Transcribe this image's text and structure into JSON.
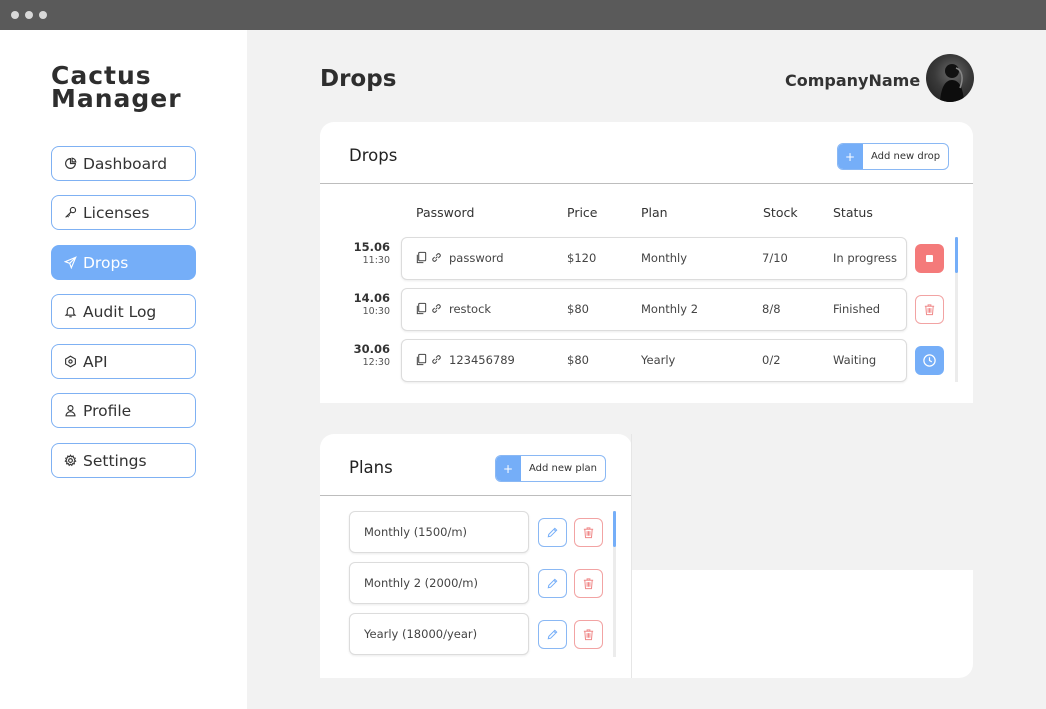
{
  "sidebar": {
    "brand_line1": "Cactus",
    "brand_line2": "Manager",
    "items": [
      {
        "label": "Dashboard",
        "icon": "pie-chart-icon"
      },
      {
        "label": "Licenses",
        "icon": "key-icon"
      },
      {
        "label": "Drops",
        "icon": "send-icon",
        "active": true
      },
      {
        "label": "Audit Log",
        "icon": "bell-icon"
      },
      {
        "label": "API",
        "icon": "api-icon"
      },
      {
        "label": "Profile",
        "icon": "user-icon"
      },
      {
        "label": "Settings",
        "icon": "gear-icon"
      }
    ]
  },
  "header": {
    "title": "Drops",
    "company": "CompanyName",
    "avatar_icon": "avatar"
  },
  "drops_card": {
    "title": "Drops",
    "add_label": "Add new drop",
    "columns": [
      "Password",
      "Price",
      "Plan",
      "Stock",
      "Status"
    ],
    "rows": [
      {
        "date": "15.06",
        "time": "11:30",
        "password": "password",
        "price": "$120",
        "plan": "Monthly",
        "stock": "7/10",
        "status": "In progress",
        "action": "stop-icon"
      },
      {
        "date": "14.06",
        "time": "10:30",
        "password": "restock",
        "price": "$80",
        "plan": "Monthly 2",
        "stock": "8/8",
        "status": "Finished",
        "action": "trash-icon"
      },
      {
        "date": "30.06",
        "time": "12:30",
        "password": "123456789",
        "price": "$80",
        "plan": "Yearly",
        "stock": "0/2",
        "status": "Waiting",
        "action": "clock-icon"
      }
    ]
  },
  "plans_card": {
    "title": "Plans",
    "add_label": "Add new plan",
    "items": [
      {
        "label": "Monthly (1500/m)"
      },
      {
        "label": "Monthly 2 (2000/m)"
      },
      {
        "label": "Yearly (18000/year)"
      }
    ]
  },
  "colors": {
    "accent": "#75aef8",
    "danger": "#f47a7a",
    "background": "#f2f2f2",
    "titlebar": "#5a5a5a"
  }
}
